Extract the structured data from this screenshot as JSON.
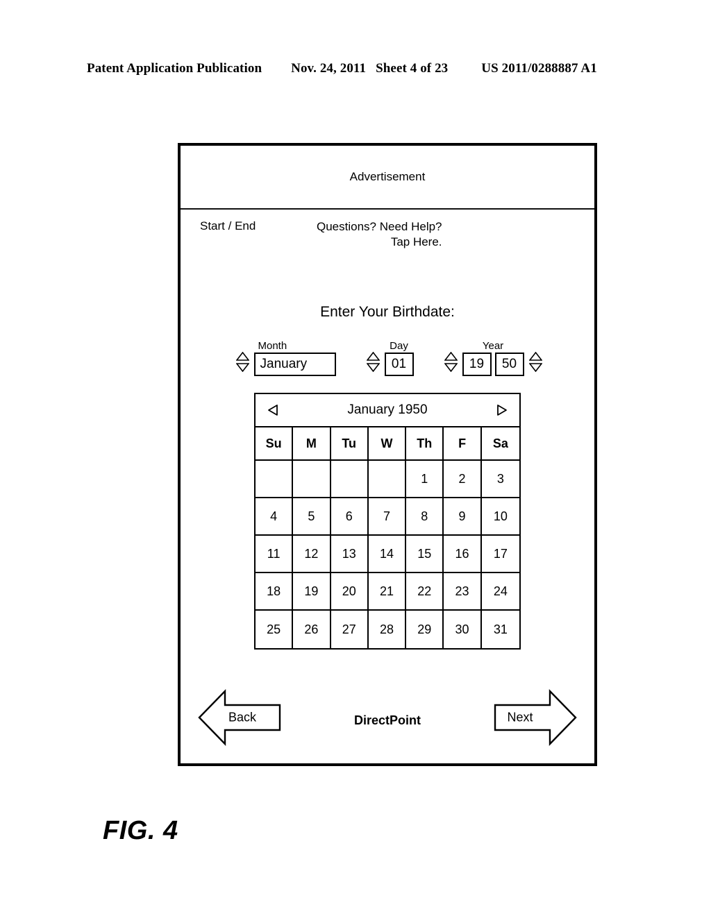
{
  "page_header": {
    "publication": "Patent Application Publication",
    "date": "Nov. 24, 2011",
    "sheet": "Sheet 4 of 23",
    "patent_number": "US 2011/0288887 A1"
  },
  "figure": {
    "caption": "FIG. 4"
  },
  "screen": {
    "advertisement": "Advertisement",
    "start_end": "Start / End",
    "help_line1": "Questions? Need Help?",
    "help_line2": "Tap Here.",
    "heading": "Enter Your Birthdate:"
  },
  "birthdate_form": {
    "month": {
      "label": "Month",
      "value": "January",
      "up_icon": "triangle-up-icon",
      "down_icon": "triangle-down-icon"
    },
    "day": {
      "label": "Day",
      "value": "01",
      "up_icon": "triangle-up-icon",
      "down_icon": "triangle-down-icon"
    },
    "year": {
      "label": "Year",
      "century_value": "19",
      "decade_value": "50",
      "left_up_icon": "triangle-up-icon",
      "left_down_icon": "triangle-down-icon",
      "right_up_icon": "triangle-up-icon",
      "right_down_icon": "triangle-down-icon"
    }
  },
  "calendar": {
    "title": "January 1950",
    "prev_icon": "triangle-left-icon",
    "next_icon": "triangle-right-icon",
    "day_headers": [
      "Su",
      "M",
      "Tu",
      "W",
      "Th",
      "F",
      "Sa"
    ],
    "weeks": [
      [
        "",
        "",
        "",
        "",
        "1",
        "2",
        "3"
      ],
      [
        "4",
        "5",
        "6",
        "7",
        "8",
        "9",
        "10"
      ],
      [
        "11",
        "12",
        "13",
        "14",
        "15",
        "16",
        "17"
      ],
      [
        "18",
        "19",
        "20",
        "21",
        "22",
        "23",
        "24"
      ],
      [
        "25",
        "26",
        "27",
        "28",
        "29",
        "30",
        "31"
      ]
    ]
  },
  "navigation": {
    "back_label": "Back",
    "next_label": "Next",
    "brand": "DirectPoint"
  },
  "colors": {
    "ink": "#000000",
    "paper": "#ffffff"
  }
}
